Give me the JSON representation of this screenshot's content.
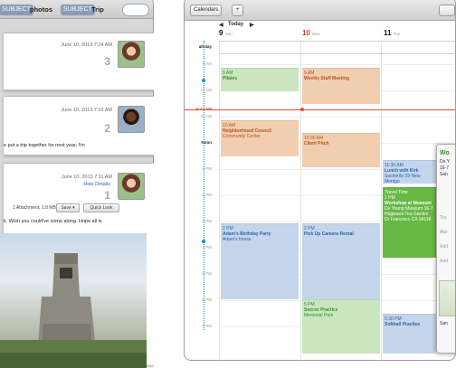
{
  "mail": {
    "search_tokens": [
      {
        "tag": "SUBJECT",
        "word": "photos"
      },
      {
        "tag": "SUBJECT",
        "word": "Trip"
      }
    ],
    "messages": [
      {
        "date": "June 10, 2013  7:24 AM",
        "count": "3",
        "body": ""
      },
      {
        "date": "June 10, 2013  7:22 AM",
        "count": "2",
        "body": "e put a trip together for next year, I'm"
      },
      {
        "date": "June 10, 2013  7:11 AM",
        "count": "1",
        "hide": "Hide Details",
        "attachment": "1 Attachment, 1.8 MB",
        "save": "Save ▾",
        "quicklook": "Quick Look",
        "body": "k. Wish you could've come along. Hope all is"
      }
    ]
  },
  "calendar": {
    "calendars_button": "Calendars",
    "add_button": "+",
    "nav": {
      "prev": "◀",
      "today": "Today",
      "next": "▶"
    },
    "days": [
      {
        "num": "9",
        "dow": "Sun"
      },
      {
        "num": "10",
        "dow": "Mon"
      },
      {
        "num": "11",
        "dow": "Tue"
      }
    ],
    "allday_label": "all-day",
    "hours": [
      "9 AM",
      "10 AM",
      "11 AM",
      "Noon",
      "1 PM",
      "2 PM",
      "3 PM",
      "4 PM",
      "5 PM",
      "6 PM",
      "7 PM"
    ],
    "current_time": "9:41 AM",
    "events": [
      {
        "time": "9 AM",
        "name": "Pilates",
        "loc": ""
      },
      {
        "time": "9 AM",
        "name": "Weekly Staff Meeting",
        "loc": ""
      },
      {
        "time": "10 AM",
        "name": "Neighborhood Council",
        "loc": "Community Center"
      },
      {
        "time": "10:30 AM",
        "name": "Client Pitch",
        "loc": ""
      },
      {
        "time": "11:30 AM",
        "name": "Lunch with Kirk",
        "loc": "Sushirrito 59 New Montgo"
      },
      {
        "time": "Travel Time",
        "name": "",
        "loc": ""
      },
      {
        "time": "1 PM",
        "name": "Workshop at Museum",
        "loc": "De Young Museum 16-7 Hagiwara Tea Garden Dr Francisco CA 94118"
      },
      {
        "time": "2 PM",
        "name": "Adam's Birthday Party",
        "loc": "Adam's house"
      },
      {
        "time": "2 PM",
        "name": "Pick Up Camera Rental",
        "loc": ""
      },
      {
        "time": "5 PM",
        "name": "Soccer Practice",
        "loc": "Memorial Park"
      },
      {
        "time": "5:30 PM",
        "name": "Softball Practice",
        "loc": ""
      }
    ],
    "popover": {
      "title": "Wo",
      "l1": "De Y",
      "l2": "16-7",
      "l3": "San",
      "r1": "Tra",
      "r2": "Aler",
      "r3": "Add",
      "r4": "Add",
      "r5": "San"
    }
  }
}
